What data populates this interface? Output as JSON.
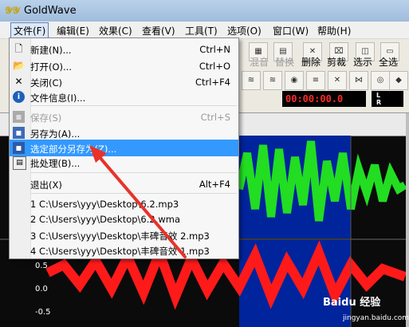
{
  "app": {
    "title": "GoldWave",
    "logo_icon": "goldwave-logo-icon"
  },
  "menubar": {
    "items": [
      "文件(F)",
      "编辑(E)",
      "效果(C)",
      "查看(V)",
      "工具(T)",
      "选项(O)",
      "窗口(W)",
      "帮助(H)"
    ]
  },
  "toolbar": {
    "labels": [
      "混音",
      "替换",
      "删除",
      "剪裁",
      "选示",
      "全选"
    ],
    "time_display": "00:00:00.0",
    "meter_l": "L",
    "meter_r": "R"
  },
  "file_menu": {
    "items": [
      {
        "label": "新建(N)...",
        "shortcut": "Ctrl+N",
        "icon": "new-file-icon"
      },
      {
        "label": "打开(O)...",
        "shortcut": "Ctrl+O",
        "icon": "open-folder-icon"
      },
      {
        "label": "关闭(C)",
        "shortcut": "Ctrl+F4",
        "icon": "close-x-icon"
      },
      {
        "label": "文件信息(I)...",
        "shortcut": "",
        "icon": "info-icon"
      },
      {
        "label": "保存(S)",
        "shortcut": "Ctrl+S",
        "icon": "save-icon"
      },
      {
        "label": "另存为(A)...",
        "shortcut": "",
        "icon": "save-as-icon"
      },
      {
        "label": "选定部分另存为(Z)...",
        "shortcut": "",
        "icon": "save-selection-icon"
      },
      {
        "label": "批处理(B)...",
        "shortcut": "",
        "icon": "batch-icon"
      },
      {
        "label": "退出(X)",
        "shortcut": "Alt+F4",
        "icon": ""
      }
    ],
    "recent": [
      "1 C:\\Users\\yyy\\Desktop\\6.2.mp3",
      "2 C:\\Users\\yyy\\Desktop\\6.2.wma",
      "3 C:\\Users\\yyy\\Desktop\\丰碑音效 2.mp3",
      "4 C:\\Users\\yyy\\Desktop\\丰碑音效 1.mp3"
    ]
  },
  "waveform": {
    "axis": [
      "0.5",
      "0.0",
      "-0.5"
    ],
    "top_color": "#22dd22",
    "bottom_color": "#ff1a1a"
  },
  "watermark": {
    "brand": "Baidu 经验",
    "site": "jingyan.baidu.com"
  }
}
